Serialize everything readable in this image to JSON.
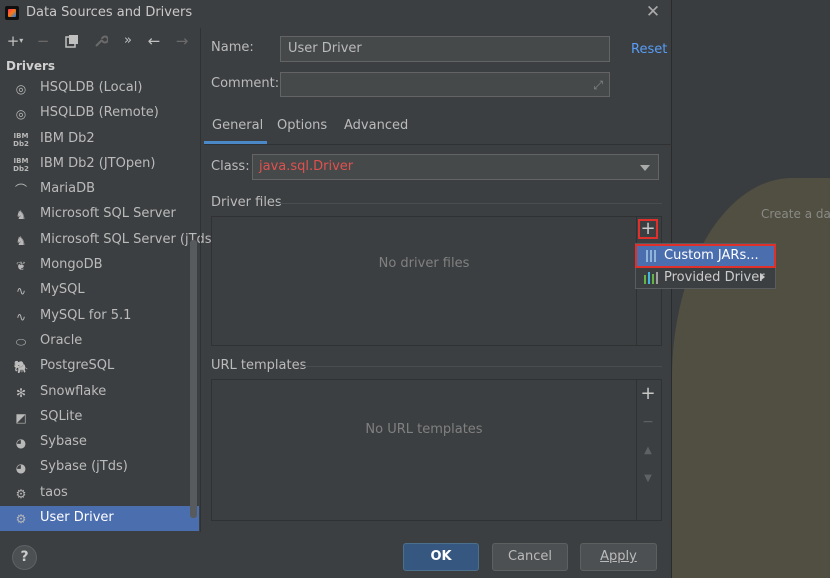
{
  "window": {
    "title": "Data Sources and Drivers",
    "close_icon": "close-icon"
  },
  "background": {
    "hint_text": "Create a dat"
  },
  "toolbar": {
    "buttons": [
      {
        "name": "add-icon",
        "glyph": "+"
      },
      {
        "name": "remove-icon",
        "glyph": "−"
      },
      {
        "name": "duplicate-icon",
        "glyph": "❐"
      },
      {
        "name": "wrench-icon",
        "glyph": "🔧"
      },
      {
        "name": "more-icon",
        "glyph": "»"
      },
      {
        "name": "back-icon",
        "glyph": "←"
      },
      {
        "name": "forward-icon",
        "glyph": "→"
      }
    ]
  },
  "sidebar": {
    "section_label": "Drivers",
    "items": [
      {
        "label": "HSQLDB (Local)",
        "icon": "hsqldb-icon"
      },
      {
        "label": "HSQLDB (Remote)",
        "icon": "hsqldb-icon"
      },
      {
        "label": "IBM Db2",
        "icon": "ibm-db2-icon"
      },
      {
        "label": "IBM Db2 (JTOpen)",
        "icon": "ibm-db2-icon"
      },
      {
        "label": "MariaDB",
        "icon": "mariadb-icon"
      },
      {
        "label": "Microsoft SQL Server",
        "icon": "mssql-icon"
      },
      {
        "label": "Microsoft SQL Server (jTds)",
        "icon": "mssql-icon"
      },
      {
        "label": "MongoDB",
        "icon": "mongodb-icon"
      },
      {
        "label": "MySQL",
        "icon": "mysql-icon"
      },
      {
        "label": "MySQL for 5.1",
        "icon": "mysql-icon"
      },
      {
        "label": "Oracle",
        "icon": "oracle-icon"
      },
      {
        "label": "PostgreSQL",
        "icon": "postgresql-icon"
      },
      {
        "label": "Snowflake",
        "icon": "snowflake-icon"
      },
      {
        "label": "SQLite",
        "icon": "sqlite-icon"
      },
      {
        "label": "Sybase",
        "icon": "sybase-icon"
      },
      {
        "label": "Sybase (jTds)",
        "icon": "sybase-icon"
      },
      {
        "label": "taos",
        "icon": "driver-icon"
      },
      {
        "label": "User Driver",
        "icon": "driver-icon",
        "selected": true
      }
    ]
  },
  "form": {
    "name_label": "Name:",
    "name_value": "User Driver",
    "reset_link": "Reset",
    "comment_label": "Comment:",
    "comment_value": "",
    "class_label": "Class:",
    "class_value": "java.sql.Driver",
    "class_value_color": "#e0514e"
  },
  "tabs": [
    {
      "label": "General",
      "active": true
    },
    {
      "label": "Options",
      "active": false
    },
    {
      "label": "Advanced",
      "active": false
    }
  ],
  "driver_files": {
    "title": "Driver files",
    "empty_text": "No driver files",
    "add_icon": "add-icon",
    "menu": [
      {
        "label": "Custom JARs...",
        "icon": "jar-icon",
        "highlighted": true
      },
      {
        "label": "Provided Driver",
        "icon": "library-icon",
        "has_submenu": true
      }
    ]
  },
  "url_templates": {
    "title": "URL templates",
    "empty_text": "No URL templates"
  },
  "footer": {
    "help": "?",
    "ok": "OK",
    "cancel": "Cancel",
    "apply": "Apply"
  },
  "colors": {
    "selection": "#4b6eaf",
    "link": "#589df6",
    "highlight_border": "#e0302b",
    "primary_button": "#365880"
  }
}
